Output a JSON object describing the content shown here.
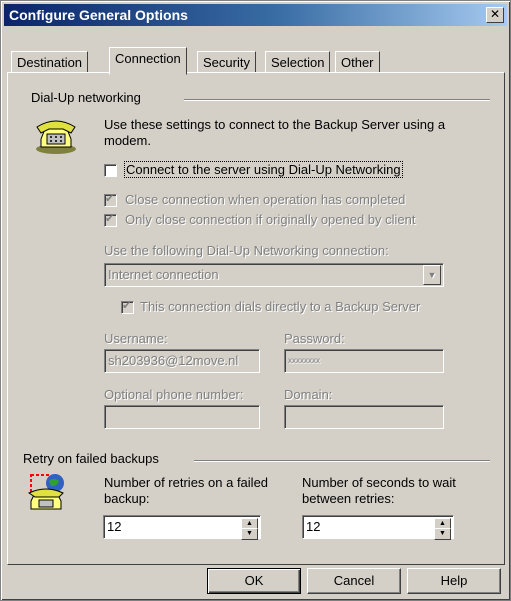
{
  "window": {
    "title": "Configure General Options"
  },
  "tabs": [
    {
      "label": "Destination"
    },
    {
      "label": "Connection",
      "active": true
    },
    {
      "label": "Security"
    },
    {
      "label": "Selection"
    },
    {
      "label": "Other"
    }
  ],
  "dialup": {
    "group_title": "Dial-Up networking",
    "description": "Use these settings to connect to the Backup Server using a modem.",
    "connect_label": "Connect to the server using Dial-Up Networking",
    "connect_checked": false,
    "close_when_complete_label": "Close connection when operation has completed",
    "close_when_complete_checked": true,
    "only_close_label": "Only close connection if originally opened by client",
    "only_close_checked": true,
    "use_connection_label": "Use the following Dial-Up Networking connection:",
    "connection_value": "Internet connection",
    "dials_directly_label": "This connection dials directly to a Backup Server",
    "dials_directly_checked": true,
    "username_label": "Username:",
    "username_value": "sh203936@12move.nl",
    "password_label": "Password:",
    "password_value": "xxxxxxxx",
    "phone_label": "Optional phone number:",
    "phone_value": "",
    "domain_label": "Domain:",
    "domain_value": ""
  },
  "retry": {
    "group_title": "Retry on failed backups",
    "retries_label": "Number of retries on a failed backup:",
    "retries_value": "12",
    "seconds_label": "Number of seconds to wait between retries:",
    "seconds_value": "12"
  },
  "buttons": {
    "ok": "OK",
    "cancel": "Cancel",
    "help": "Help"
  },
  "icons": {
    "close": "close-icon",
    "phone": "telephone-icon",
    "retry": "globe-phone-icon",
    "dropdown": "chevron-down-icon",
    "spin_up": "arrow-up-icon",
    "spin_down": "arrow-down-icon"
  }
}
